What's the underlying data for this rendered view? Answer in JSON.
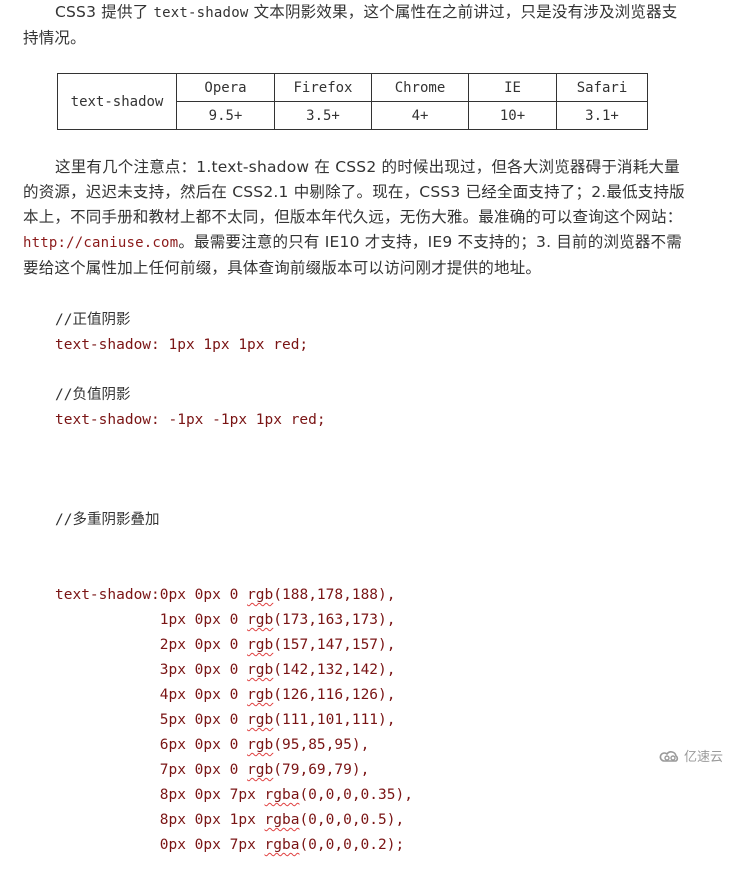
{
  "intro": {
    "before": "CSS3 提供了 ",
    "code": "text-shadow",
    "after": " 文本阴影效果，这个属性在之前讲过，只是没有涉及浏览器支持情况。"
  },
  "compat_table": {
    "row_header": "text-shadow",
    "browsers": [
      "Opera",
      "Firefox",
      "Chrome",
      "IE",
      "Safari"
    ],
    "versions": [
      "9.5+",
      "3.5+",
      "4+",
      "10+",
      "3.1+"
    ]
  },
  "notes": {
    "part1": "这里有几个注意点：1.text-shadow 在 CSS2 的时候出现过，但各大浏览器碍于消耗大量的资源，迟迟未支持，然后在 CSS2.1 中剔除了。现在，CSS3 已经全面支持了；2.最低支持版本上，不同手册和教材上都不太同，但版本年代久远，无伤大雅。最准确的可以查询这个网站：",
    "link": "http://caniuse.com",
    "part2": "。最需要注意的只有 IE10 才支持，IE9 不支持的；3. 目前的浏览器不需要给这个属性加上任何前缀，具体查询前缀版本可以访问刚才提供的地址。"
  },
  "code": {
    "block1": {
      "comment": "//正值阴影",
      "line": "text-shadow: 1px 1px 1px red;"
    },
    "block2": {
      "comment": "//负值阴影",
      "line": "text-shadow: -1px -1px 1px red;"
    },
    "block3": {
      "comment": "//多重阴影叠加",
      "prefix": "text-shadow:",
      "lines": [
        {
          "pre": "0px 0px 0 ",
          "fn": "rgb",
          "args": "(188,178,188),"
        },
        {
          "pre": "1px 0px 0 ",
          "fn": "rgb",
          "args": "(173,163,173),"
        },
        {
          "pre": "2px 0px 0 ",
          "fn": "rgb",
          "args": "(157,147,157),"
        },
        {
          "pre": "3px 0px 0 ",
          "fn": "rgb",
          "args": "(142,132,142),"
        },
        {
          "pre": "4px 0px 0 ",
          "fn": "rgb",
          "args": "(126,116,126),"
        },
        {
          "pre": "5px 0px 0 ",
          "fn": "rgb",
          "args": "(111,101,111),"
        },
        {
          "pre": "6px 0px 0 ",
          "fn": "rgb",
          "args": "(95,85,95),"
        },
        {
          "pre": "7px 0px 0 ",
          "fn": "rgb",
          "args": "(79,69,79),"
        },
        {
          "pre": "8px 0px 7px ",
          "fn": "rgba",
          "args": "(0,0,0,0.35),"
        },
        {
          "pre": "8px 0px 1px ",
          "fn": "rgba",
          "args": "(0,0,0,0.5),"
        },
        {
          "pre": "0px 0px 7px ",
          "fn": "rgba",
          "args": "(0,0,0,0.2);"
        }
      ]
    }
  },
  "watermark": {
    "icon": "cloud-logo-icon",
    "text": "亿速云"
  },
  "colors": {
    "code": "#7a1414",
    "text": "#333333",
    "squiggle": "#e04040"
  }
}
